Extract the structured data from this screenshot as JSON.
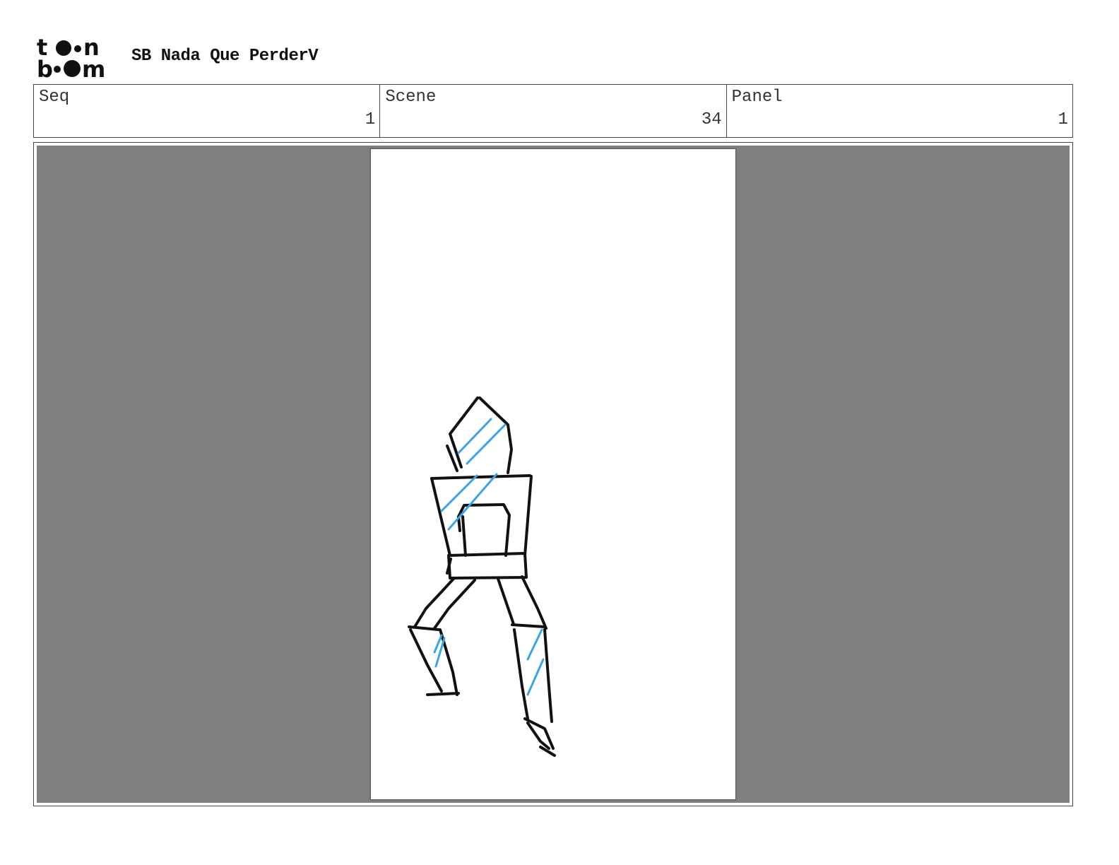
{
  "header": {
    "logo_top": "to●n",
    "logo_bottom": "b●●m",
    "project_title": "SB Nada Que PerderV"
  },
  "info": {
    "seq_label": "Seq",
    "seq_value": "1",
    "scene_label": "Scene",
    "scene_value": "34",
    "panel_label": "Panel",
    "panel_value": "1"
  },
  "panel": {
    "background_color": "#7f7f7f",
    "canvas_color": "#ffffff",
    "ink_color": "#111111",
    "shade_color": "#3aa4e6"
  }
}
